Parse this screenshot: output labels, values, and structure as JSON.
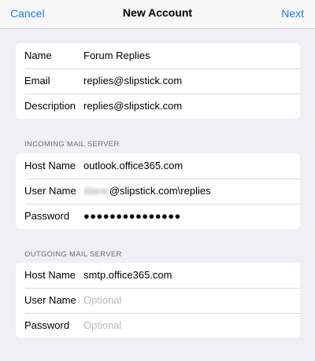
{
  "nav": {
    "cancel": "Cancel",
    "title": "New Account",
    "next": "Next"
  },
  "account": {
    "name_label": "Name",
    "name_value": "Forum Replies",
    "email_label": "Email",
    "email_value": "replies@slipstick.com",
    "description_label": "Description",
    "description_value": "replies@slipstick.com"
  },
  "incoming": {
    "header": "INCOMING MAIL SERVER",
    "host_label": "Host Name",
    "host_value": "outlook.office365.com",
    "user_label": "User Name",
    "user_value_obscured": "diane",
    "user_value": "@slipstick.com\\replies",
    "password_label": "Password",
    "password_value": "●●●●●●●●●●●●●●●"
  },
  "outgoing": {
    "header": "OUTGOING MAIL SERVER",
    "host_label": "Host Name",
    "host_value": "smtp.office365.com",
    "user_label": "User Name",
    "user_placeholder": "Optional",
    "password_label": "Password",
    "password_placeholder": "Optional"
  }
}
